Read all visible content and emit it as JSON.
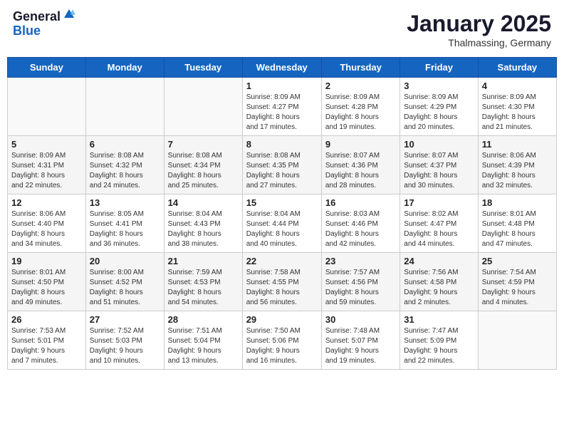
{
  "header": {
    "logo_general": "General",
    "logo_blue": "Blue",
    "month_title": "January 2025",
    "subtitle": "Thalmassing, Germany"
  },
  "days_of_week": [
    "Sunday",
    "Monday",
    "Tuesday",
    "Wednesday",
    "Thursday",
    "Friday",
    "Saturday"
  ],
  "weeks": [
    [
      {
        "day": "",
        "info": ""
      },
      {
        "day": "",
        "info": ""
      },
      {
        "day": "",
        "info": ""
      },
      {
        "day": "1",
        "info": "Sunrise: 8:09 AM\nSunset: 4:27 PM\nDaylight: 8 hours\nand 17 minutes."
      },
      {
        "day": "2",
        "info": "Sunrise: 8:09 AM\nSunset: 4:28 PM\nDaylight: 8 hours\nand 19 minutes."
      },
      {
        "day": "3",
        "info": "Sunrise: 8:09 AM\nSunset: 4:29 PM\nDaylight: 8 hours\nand 20 minutes."
      },
      {
        "day": "4",
        "info": "Sunrise: 8:09 AM\nSunset: 4:30 PM\nDaylight: 8 hours\nand 21 minutes."
      }
    ],
    [
      {
        "day": "5",
        "info": "Sunrise: 8:09 AM\nSunset: 4:31 PM\nDaylight: 8 hours\nand 22 minutes."
      },
      {
        "day": "6",
        "info": "Sunrise: 8:08 AM\nSunset: 4:32 PM\nDaylight: 8 hours\nand 24 minutes."
      },
      {
        "day": "7",
        "info": "Sunrise: 8:08 AM\nSunset: 4:34 PM\nDaylight: 8 hours\nand 25 minutes."
      },
      {
        "day": "8",
        "info": "Sunrise: 8:08 AM\nSunset: 4:35 PM\nDaylight: 8 hours\nand 27 minutes."
      },
      {
        "day": "9",
        "info": "Sunrise: 8:07 AM\nSunset: 4:36 PM\nDaylight: 8 hours\nand 28 minutes."
      },
      {
        "day": "10",
        "info": "Sunrise: 8:07 AM\nSunset: 4:37 PM\nDaylight: 8 hours\nand 30 minutes."
      },
      {
        "day": "11",
        "info": "Sunrise: 8:06 AM\nSunset: 4:39 PM\nDaylight: 8 hours\nand 32 minutes."
      }
    ],
    [
      {
        "day": "12",
        "info": "Sunrise: 8:06 AM\nSunset: 4:40 PM\nDaylight: 8 hours\nand 34 minutes."
      },
      {
        "day": "13",
        "info": "Sunrise: 8:05 AM\nSunset: 4:41 PM\nDaylight: 8 hours\nand 36 minutes."
      },
      {
        "day": "14",
        "info": "Sunrise: 8:04 AM\nSunset: 4:43 PM\nDaylight: 8 hours\nand 38 minutes."
      },
      {
        "day": "15",
        "info": "Sunrise: 8:04 AM\nSunset: 4:44 PM\nDaylight: 8 hours\nand 40 minutes."
      },
      {
        "day": "16",
        "info": "Sunrise: 8:03 AM\nSunset: 4:46 PM\nDaylight: 8 hours\nand 42 minutes."
      },
      {
        "day": "17",
        "info": "Sunrise: 8:02 AM\nSunset: 4:47 PM\nDaylight: 8 hours\nand 44 minutes."
      },
      {
        "day": "18",
        "info": "Sunrise: 8:01 AM\nSunset: 4:48 PM\nDaylight: 8 hours\nand 47 minutes."
      }
    ],
    [
      {
        "day": "19",
        "info": "Sunrise: 8:01 AM\nSunset: 4:50 PM\nDaylight: 8 hours\nand 49 minutes."
      },
      {
        "day": "20",
        "info": "Sunrise: 8:00 AM\nSunset: 4:52 PM\nDaylight: 8 hours\nand 51 minutes."
      },
      {
        "day": "21",
        "info": "Sunrise: 7:59 AM\nSunset: 4:53 PM\nDaylight: 8 hours\nand 54 minutes."
      },
      {
        "day": "22",
        "info": "Sunrise: 7:58 AM\nSunset: 4:55 PM\nDaylight: 8 hours\nand 56 minutes."
      },
      {
        "day": "23",
        "info": "Sunrise: 7:57 AM\nSunset: 4:56 PM\nDaylight: 8 hours\nand 59 minutes."
      },
      {
        "day": "24",
        "info": "Sunrise: 7:56 AM\nSunset: 4:58 PM\nDaylight: 9 hours\nand 2 minutes."
      },
      {
        "day": "25",
        "info": "Sunrise: 7:54 AM\nSunset: 4:59 PM\nDaylight: 9 hours\nand 4 minutes."
      }
    ],
    [
      {
        "day": "26",
        "info": "Sunrise: 7:53 AM\nSunset: 5:01 PM\nDaylight: 9 hours\nand 7 minutes."
      },
      {
        "day": "27",
        "info": "Sunrise: 7:52 AM\nSunset: 5:03 PM\nDaylight: 9 hours\nand 10 minutes."
      },
      {
        "day": "28",
        "info": "Sunrise: 7:51 AM\nSunset: 5:04 PM\nDaylight: 9 hours\nand 13 minutes."
      },
      {
        "day": "29",
        "info": "Sunrise: 7:50 AM\nSunset: 5:06 PM\nDaylight: 9 hours\nand 16 minutes."
      },
      {
        "day": "30",
        "info": "Sunrise: 7:48 AM\nSunset: 5:07 PM\nDaylight: 9 hours\nand 19 minutes."
      },
      {
        "day": "31",
        "info": "Sunrise: 7:47 AM\nSunset: 5:09 PM\nDaylight: 9 hours\nand 22 minutes."
      },
      {
        "day": "",
        "info": ""
      }
    ]
  ]
}
